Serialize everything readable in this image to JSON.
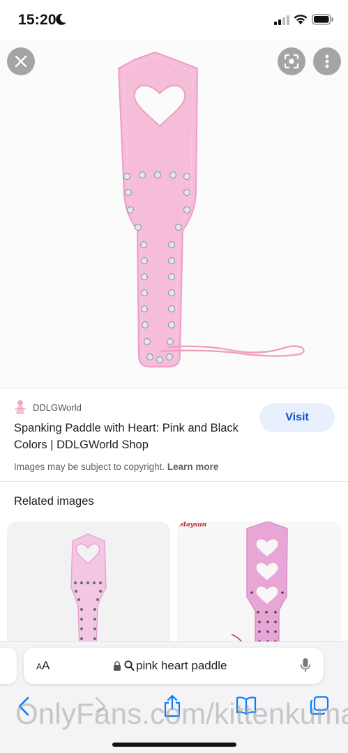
{
  "status_bar": {
    "time": "15:20"
  },
  "image_viewer": {
    "close_icon": "close-icon",
    "lens_icon": "google-lens-icon",
    "more_icon": "more-vert-icon"
  },
  "result": {
    "source_name": "DDLGWorld",
    "title": "Spanking Paddle with Heart: Pink and Black Colors | DDLGWorld Shop",
    "visit_label": "Visit",
    "copyright_text": "Images may be subject to copyright.",
    "learn_more_label": "Learn more"
  },
  "related": {
    "heading": "Related images",
    "card2_brand": "Maysun"
  },
  "browser": {
    "aa_small": "A",
    "aa_large": "A",
    "address": "pink heart paddle"
  },
  "watermark": "OnlyFans.com/kittenkuma",
  "colors": {
    "paddle_pink": "#f5bdd8",
    "visit_bg": "#e8f0fe",
    "visit_text": "#0b57d0",
    "ios_blue": "#0a7aff"
  }
}
